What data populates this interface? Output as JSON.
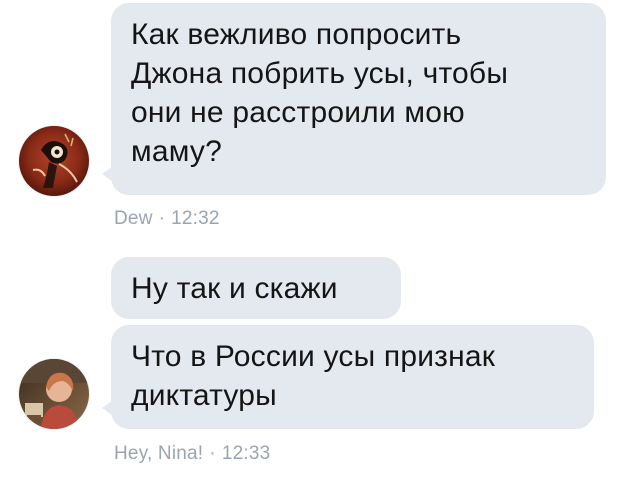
{
  "colors": {
    "bubble_background": "#e4e8ef",
    "message_text": "#151515",
    "meta_text": "#9aa4b1",
    "page_background": "#ffffff"
  },
  "messages": [
    {
      "author": "Dew",
      "time": "12:32",
      "separator": "·",
      "avatar": "user-avatar-illustration",
      "bubbles": [
        "Как вежливо попросить\nДжона побрить усы, чтобы\nони не расстроили мою\nмаму?"
      ]
    },
    {
      "author": "Hey, Nina!",
      "time": "12:33",
      "separator": "·",
      "avatar": "user-avatar-photo",
      "bubbles": [
        "Ну так и скажи",
        "Что в России усы признак\nдиктатуры"
      ]
    }
  ]
}
